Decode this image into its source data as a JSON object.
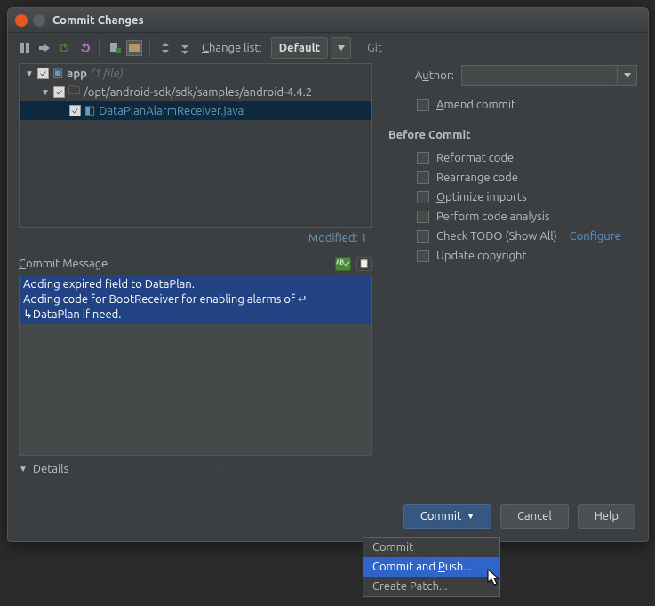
{
  "title": "Commit Changes",
  "toolbar": {
    "change_list_label": "Change list:",
    "change_list_value": "Default",
    "vcs_label": "Git"
  },
  "tree": {
    "app_label": "app",
    "app_suffix": "(1 file)",
    "path_label": "/opt/android-sdk/sdk/samples/android-4.4.2",
    "file_label": "DataPlanAlarmReceiver.java"
  },
  "modified_label": "Modified: 1",
  "commit_msg_label": "Commit Message",
  "commit_msg_lines": {
    "l1": "Adding expired field to DataPlan.",
    "l2": "Adding code for BootReceiver for enabling alarms of ↵",
    "l3": "↳DataPlan if need."
  },
  "details_label": "Details",
  "right": {
    "author_label": "Author:",
    "amend_label": "mend commit",
    "amend_mn": "A",
    "section_before": "Before Commit",
    "reformat": "eformat code",
    "reformat_mn": "R",
    "rearrange": "Rearrange code",
    "optimize": "ptimize imports",
    "optimize_mn": "O",
    "perform": "Perform code analysis",
    "todo": "Check TODO (Show All)",
    "configure": "Configure",
    "update": "Update copyright"
  },
  "buttons": {
    "commit": "Commit",
    "cancel": "Cancel",
    "help": "Help"
  },
  "menu": {
    "commit": "Commit",
    "commit_push": "Commit and Push...",
    "create_patch": "Create Patch..."
  }
}
